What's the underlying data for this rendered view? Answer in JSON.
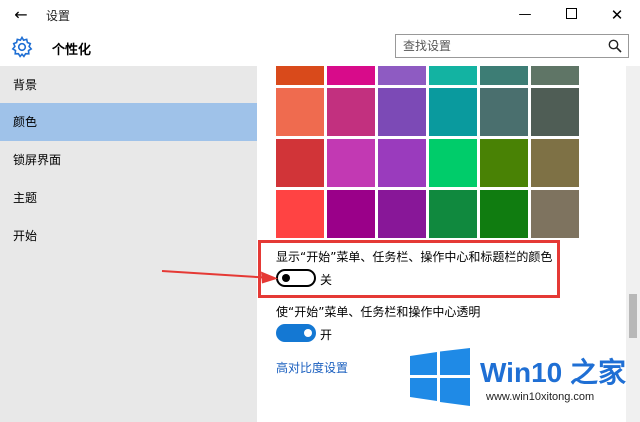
{
  "window": {
    "title": "设置",
    "back_icon": "←",
    "minimize_icon": "—",
    "close_icon": "✕"
  },
  "header": {
    "section_title": "个性化",
    "search_placeholder": "查找设置"
  },
  "sidebar": {
    "items": [
      {
        "label": "背景",
        "selected": false
      },
      {
        "label": "颜色",
        "selected": true
      },
      {
        "label": "锁屏界面",
        "selected": false
      },
      {
        "label": "主题",
        "selected": false
      },
      {
        "label": "开始",
        "selected": false
      }
    ]
  },
  "colors": {
    "swatches": [
      [
        "#d94a1b",
        "#d80b8a",
        "#8e5bc2",
        "#13b3a2",
        "#3d7d75",
        "#5f7566"
      ],
      [
        "#ef6b4f",
        "#c2307f",
        "#7c4ab6",
        "#0a9a9e",
        "#4a6f6e",
        "#4f5d55"
      ],
      [
        "#d13438",
        "#c239b3",
        "#9a3bbd",
        "#00cc6a",
        "#498205",
        "#7e7145"
      ],
      [
        "#ff4343",
        "#9a0089",
        "#881798",
        "#10893e",
        "#107c10",
        "#7e735f"
      ]
    ],
    "accent": "#1478d3",
    "highlight": "#e53935"
  },
  "options": {
    "accent_titlebar": {
      "label": "显示“开始”菜单、任务栏、操作中心和标题栏的颜色",
      "state_label": "关",
      "on": false
    },
    "transparency": {
      "label": "使“开始”菜单、任务栏和操作中心透明",
      "state_label": "开",
      "on": true
    },
    "high_contrast_link": "高对比度设置"
  },
  "watermark": {
    "title": "Win10 之家",
    "url": "www.win10xitong.com"
  }
}
